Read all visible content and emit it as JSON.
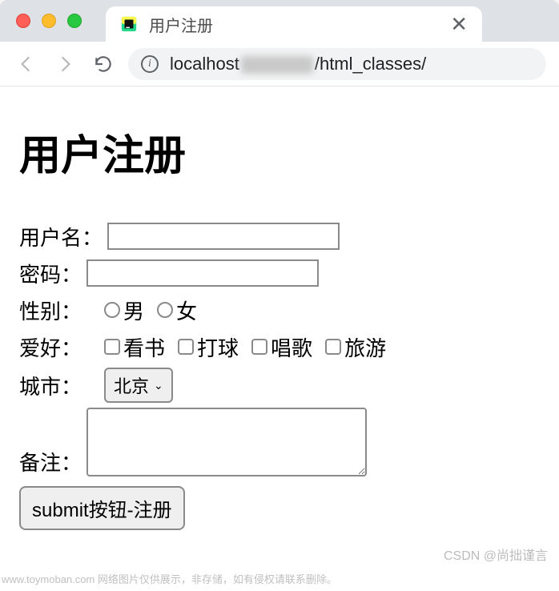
{
  "browser": {
    "tab_title": "用户注册",
    "close_glyph": "✕",
    "url_host": "localhost",
    "url_path_suffix": "/html_classes/"
  },
  "page": {
    "heading": "用户注册"
  },
  "form": {
    "username_label": "用户名：",
    "password_label": "密码：",
    "gender_label": "性别：",
    "gender_options": [
      "男",
      "女"
    ],
    "hobby_label": "爱好：",
    "hobby_options": [
      "看书",
      "打球",
      "唱歌",
      "旅游"
    ],
    "city_label": "城市：",
    "city_selected": "北京",
    "remark_label": "备注：",
    "submit_label": "submit按钮-注册"
  },
  "watermark": {
    "bottom_right": "CSDN @尚拙谨言",
    "bottom_left": "www.toymoban.com 网络图片仅供展示，非存储，如有侵权请联系删除。"
  }
}
